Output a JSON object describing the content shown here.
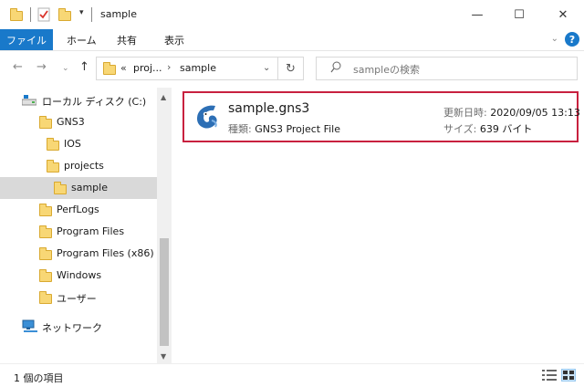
{
  "titlebar": {
    "title": "sample",
    "minimize": "—",
    "maximize": "☐",
    "close": "✕"
  },
  "ribbon": {
    "file_tab": "ファイル",
    "tabs": [
      "ホーム",
      "共有",
      "表示"
    ],
    "help": "?"
  },
  "nav": {
    "breadcrumb_ellipsis": "«",
    "breadcrumb_parent": "proj...",
    "breadcrumb_current": "sample",
    "search_placeholder": "sampleの検索"
  },
  "sidebar": {
    "items": [
      {
        "label": "ローカル ディスク (C:)",
        "icon": "drive-icon"
      },
      {
        "label": "GNS3",
        "icon": "folder-icon"
      },
      {
        "label": "IOS",
        "icon": "folder-icon"
      },
      {
        "label": "projects",
        "icon": "folder-icon"
      },
      {
        "label": "sample",
        "icon": "folder-icon",
        "selected": true
      },
      {
        "label": "PerfLogs",
        "icon": "folder-icon"
      },
      {
        "label": "Program Files",
        "icon": "folder-icon"
      },
      {
        "label": "Program Files (x86)",
        "icon": "folder-icon"
      },
      {
        "label": "Windows",
        "icon": "folder-icon"
      },
      {
        "label": "ユーザー",
        "icon": "folder-icon"
      },
      {
        "label": "ネットワーク",
        "icon": "network-icon"
      }
    ]
  },
  "file": {
    "name": "sample.gns3",
    "type_label": "種類:",
    "type_value": "GNS3 Project File",
    "modified_label": "更新日時:",
    "modified_value": "2020/09/05 13:13",
    "size_label": "サイズ:",
    "size_value": "639 バイト"
  },
  "status": {
    "item_count": "1 個の項目"
  },
  "colors": {
    "accent": "#1979ca",
    "highlight_border": "#c8213f",
    "folder": "#f8d775",
    "selection": "#d9d9d9"
  }
}
